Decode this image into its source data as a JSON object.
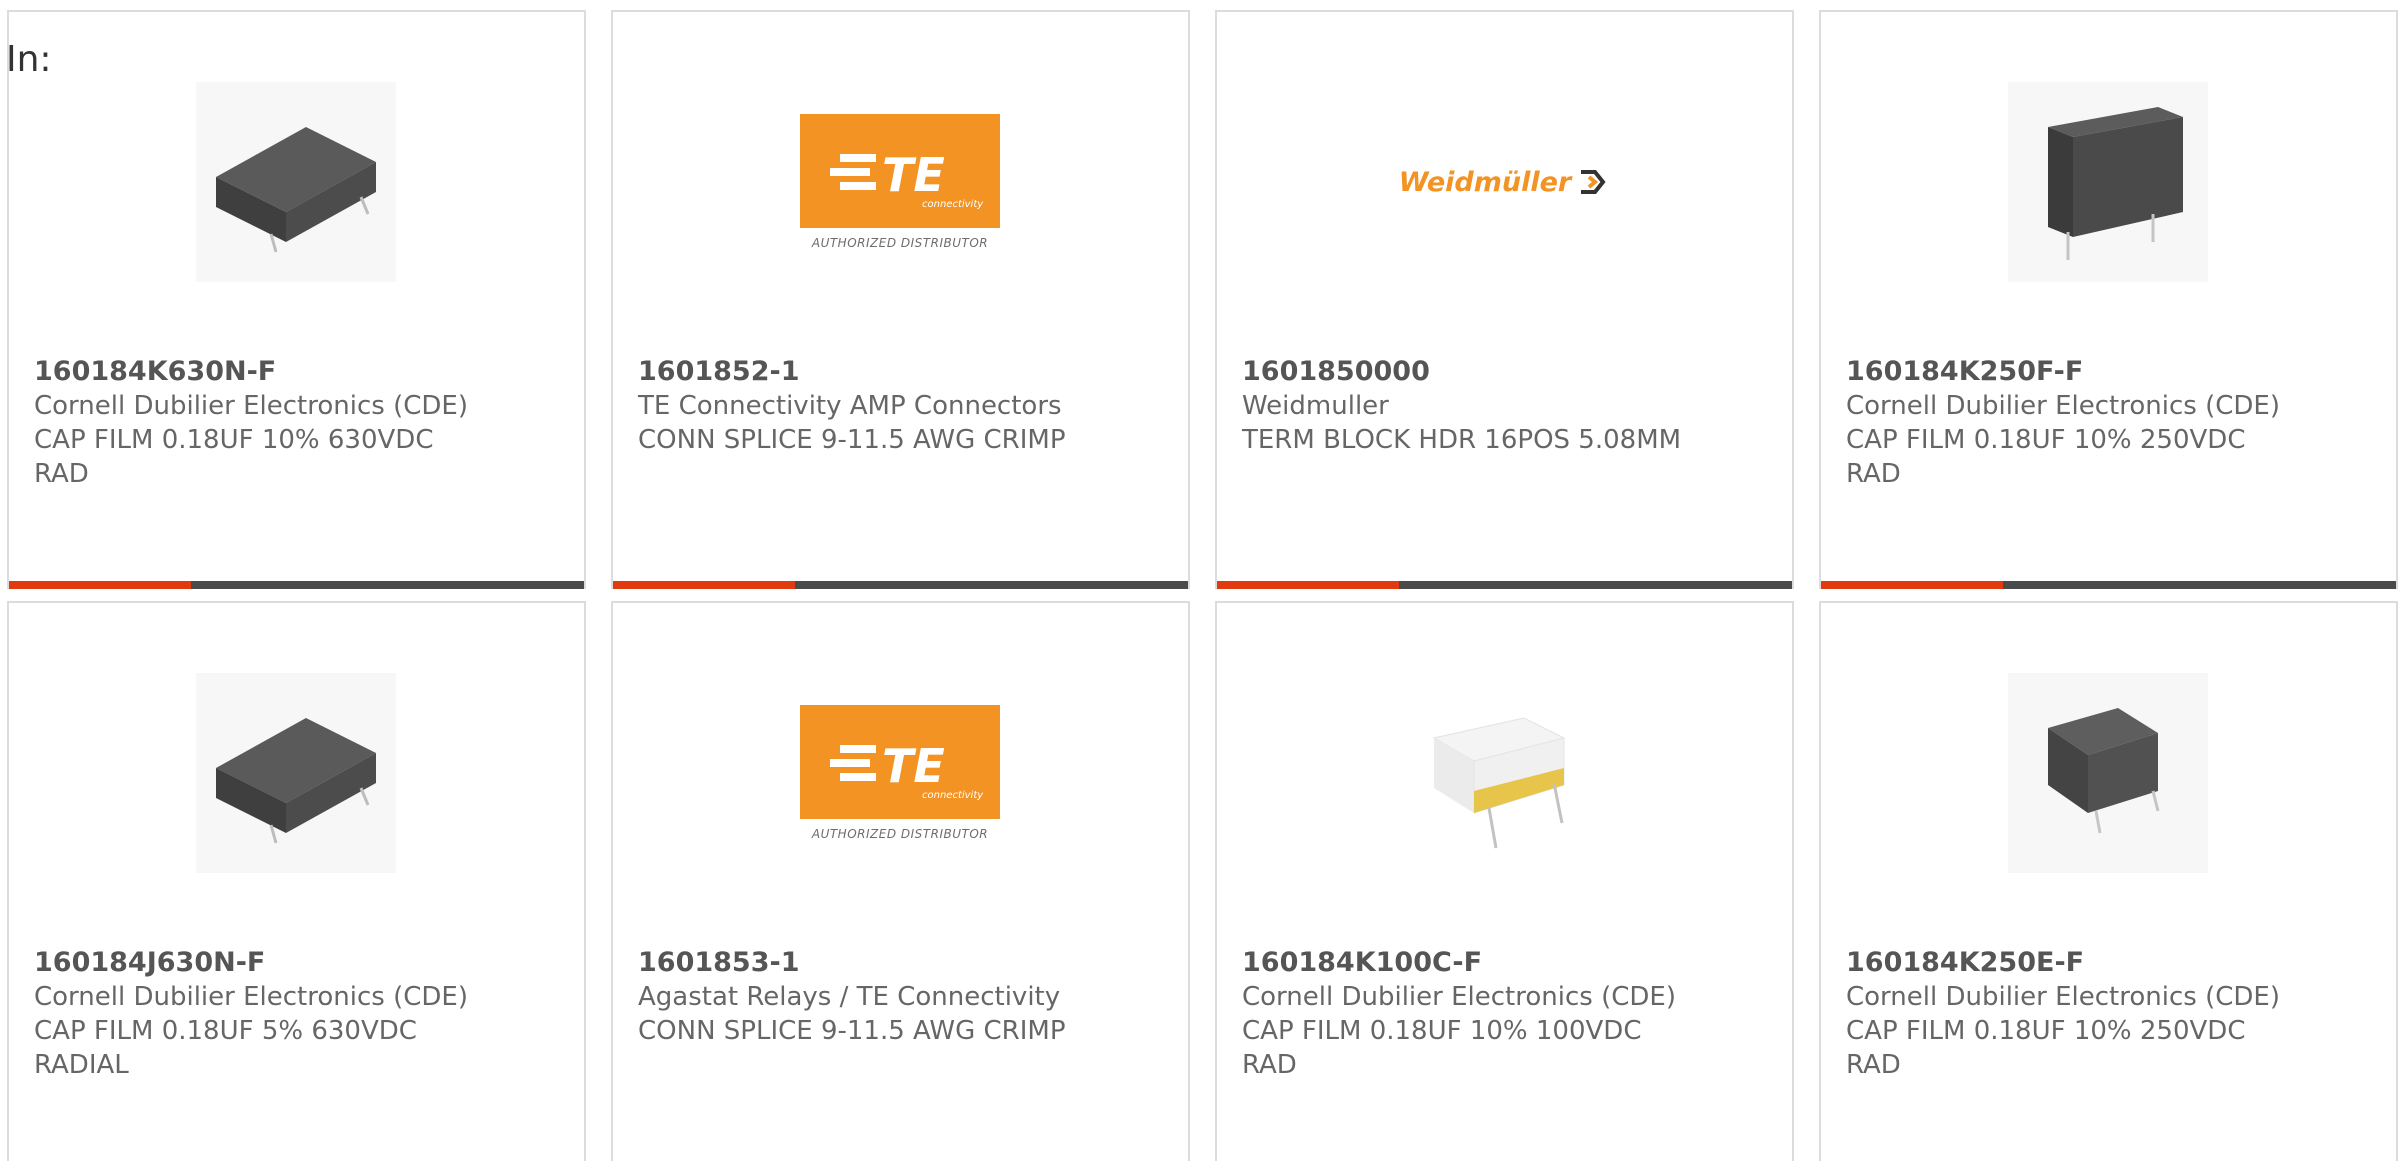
{
  "header": {
    "in_label": "In:"
  },
  "logos": {
    "te_text": "TE",
    "te_sub": "connectivity",
    "te_caption": "AUTHORIZED DISTRIBUTOR",
    "weidmuller_text": "Weidmüller"
  },
  "colors": {
    "accent": "#e03a0e",
    "bar": "#4a4a4a",
    "te_orange": "#f39323"
  },
  "products": [
    {
      "part": "160184K630N-F",
      "manufacturer": "Cornell Dubilier Electronics (CDE)",
      "desc1": "CAP FILM 0.18UF 10% 630VDC",
      "desc2": "RAD",
      "image": "film-capacitor-black"
    },
    {
      "part": "1601852-1",
      "manufacturer": "TE Connectivity AMP Connectors",
      "desc1": "CONN SPLICE 9-11.5 AWG CRIMP",
      "desc2": "",
      "image": "te-logo"
    },
    {
      "part": "1601850000",
      "manufacturer": "Weidmuller",
      "desc1": "TERM BLOCK HDR 16POS 5.08MM",
      "desc2": "",
      "image": "weidmuller-logo"
    },
    {
      "part": "160184K250F-F",
      "manufacturer": "Cornell Dubilier Electronics (CDE)",
      "desc1": "CAP FILM 0.18UF 10% 250VDC",
      "desc2": "RAD",
      "image": "film-capacitor-tall"
    },
    {
      "part": "160184J630N-F",
      "manufacturer": "Cornell Dubilier Electronics (CDE)",
      "desc1": "CAP FILM 0.18UF 5% 630VDC",
      "desc2": "RADIAL",
      "image": "film-capacitor-black"
    },
    {
      "part": "1601853-1",
      "manufacturer": "Agastat Relays / TE Connectivity",
      "desc1": "CONN SPLICE 9-11.5 AWG CRIMP",
      "desc2": "",
      "image": "te-logo"
    },
    {
      "part": "160184K100C-F",
      "manufacturer": "Cornell Dubilier Electronics (CDE)",
      "desc1": "CAP FILM 0.18UF 10% 100VDC",
      "desc2": "RAD",
      "image": "film-capacitor-white"
    },
    {
      "part": "160184K250E-F",
      "manufacturer": "Cornell Dubilier Electronics (CDE)",
      "desc1": "CAP FILM 0.18UF 10% 250VDC",
      "desc2": "RAD",
      "image": "film-capacitor-small"
    }
  ]
}
